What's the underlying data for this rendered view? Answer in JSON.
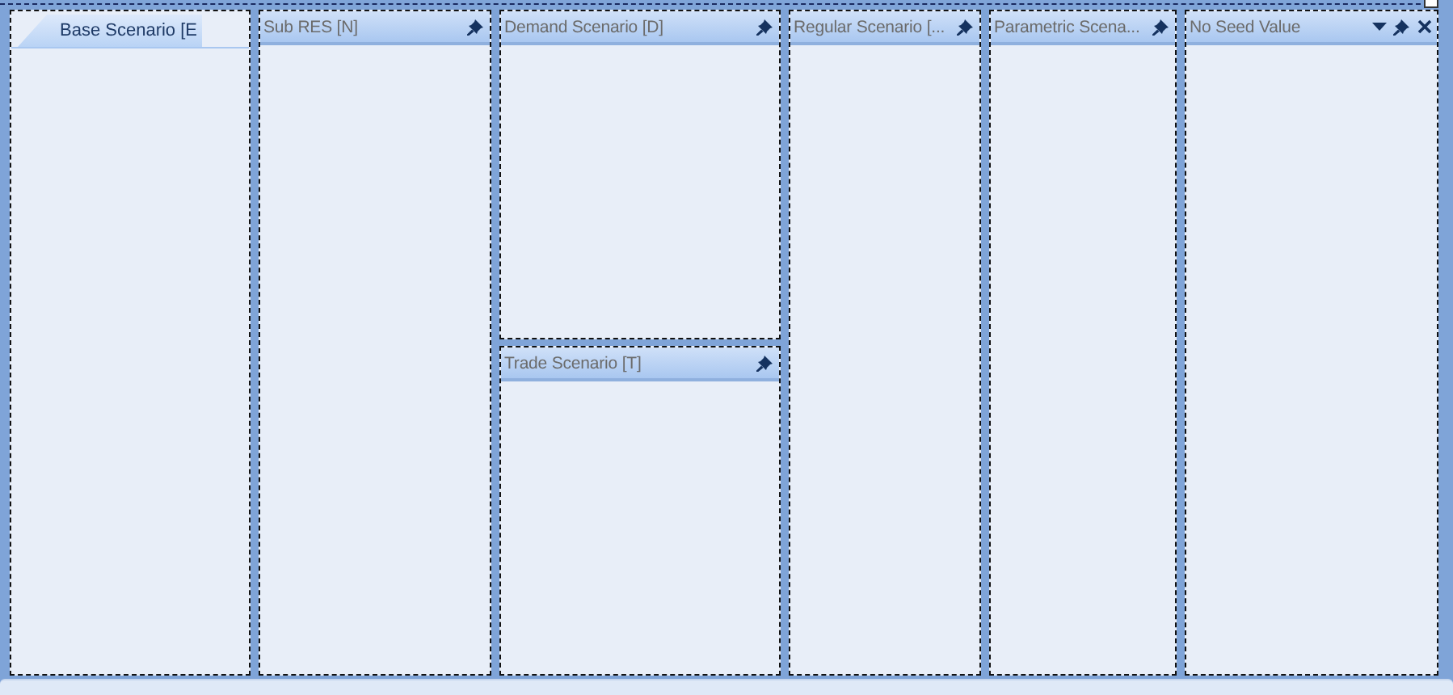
{
  "document_tab": {
    "label": "Base Scenario [E",
    "selected": true
  },
  "columns": [
    {
      "panes": [
        {
          "title": "Sub RES [N]",
          "controls": [
            {
              "kind": "pin"
            }
          ]
        }
      ]
    },
    {
      "panes": [
        {
          "title": "Demand Scenario [D]",
          "controls": [
            {
              "kind": "pin"
            }
          ]
        },
        {
          "title": "Trade Scenario [T]",
          "controls": [
            {
              "kind": "pin"
            }
          ]
        }
      ]
    },
    {
      "panes": [
        {
          "title": "Regular Scenario [...",
          "controls": [
            {
              "kind": "pin"
            }
          ]
        }
      ]
    },
    {
      "panes": [
        {
          "title": "Parametric Scena...",
          "controls": [
            {
              "kind": "pin"
            }
          ]
        }
      ]
    },
    {
      "panes": [
        {
          "title": "No Seed Value",
          "controls": [
            {
              "kind": "menu"
            },
            {
              "kind": "pin"
            },
            {
              "kind": "close"
            }
          ]
        }
      ]
    }
  ]
}
